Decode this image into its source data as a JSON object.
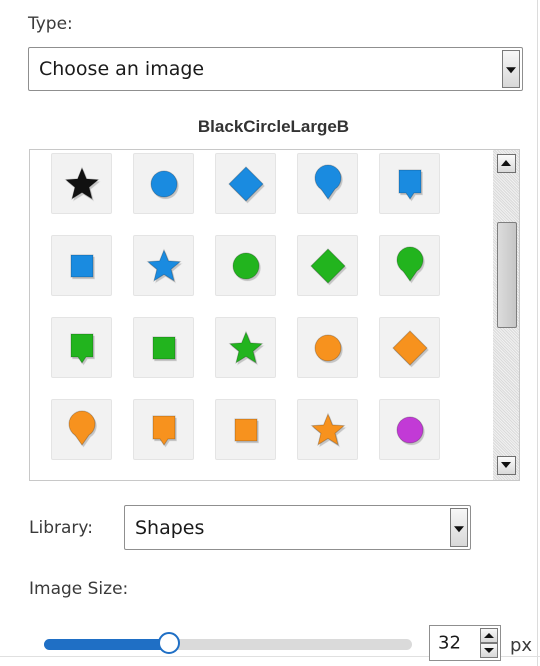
{
  "type_field": {
    "label": "Type:",
    "selected": "Choose an image"
  },
  "selected_image_name": "BlackCircleLargeB",
  "gallery": {
    "items": [
      {
        "shape": "star",
        "color": "#111111",
        "icon": "star-icon"
      },
      {
        "shape": "circle",
        "color": "#1a8be0",
        "icon": "circle-icon"
      },
      {
        "shape": "diamond",
        "color": "#1a8be0",
        "icon": "diamond-icon"
      },
      {
        "shape": "pin",
        "color": "#1a8be0",
        "icon": "pin-icon"
      },
      {
        "shape": "callout",
        "color": "#1a8be0",
        "icon": "callout-icon"
      },
      {
        "shape": "square",
        "color": "#1a8be0",
        "icon": "square-icon"
      },
      {
        "shape": "star",
        "color": "#1a8be0",
        "icon": "star-icon"
      },
      {
        "shape": "circle",
        "color": "#22b41e",
        "icon": "circle-icon"
      },
      {
        "shape": "diamond",
        "color": "#22b41e",
        "icon": "diamond-icon"
      },
      {
        "shape": "pin",
        "color": "#22b41e",
        "icon": "pin-icon"
      },
      {
        "shape": "callout",
        "color": "#22b41e",
        "icon": "callout-icon"
      },
      {
        "shape": "square",
        "color": "#22b41e",
        "icon": "square-icon"
      },
      {
        "shape": "star",
        "color": "#22b41e",
        "icon": "star-icon"
      },
      {
        "shape": "circle",
        "color": "#f7921e",
        "icon": "circle-icon"
      },
      {
        "shape": "diamond",
        "color": "#f7921e",
        "icon": "diamond-icon"
      },
      {
        "shape": "pin",
        "color": "#f7921e",
        "icon": "pin-icon"
      },
      {
        "shape": "callout",
        "color": "#f7921e",
        "icon": "callout-icon"
      },
      {
        "shape": "square",
        "color": "#f7921e",
        "icon": "square-icon"
      },
      {
        "shape": "star",
        "color": "#f7921e",
        "icon": "star-icon"
      },
      {
        "shape": "circle",
        "color": "#c23ad6",
        "icon": "circle-icon"
      }
    ],
    "partial_row_tiles": 5,
    "scrollbar": {
      "up_icon": "arrow-up-icon",
      "down_icon": "arrow-down-icon"
    }
  },
  "library_field": {
    "label": "Library:",
    "selected": "Shapes"
  },
  "image_size": {
    "label": "Image Size:",
    "slider_fraction": 0.34,
    "value": "32",
    "unit": "px"
  }
}
